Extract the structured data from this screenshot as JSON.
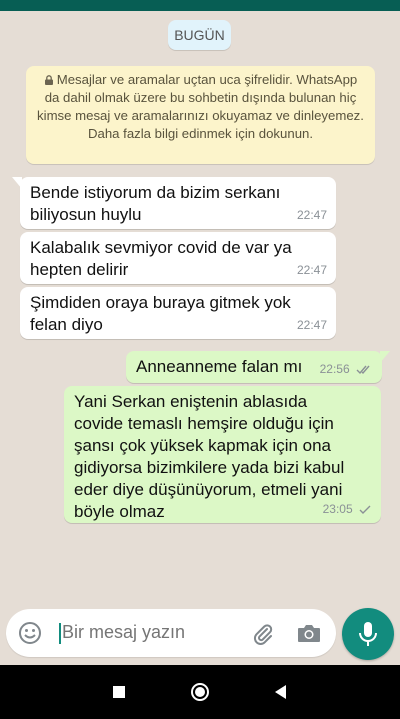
{
  "chat": {
    "date_chip": "BUGÜN",
    "notice": "Mesajlar ve aramalar uçtan uca şifrelidir. WhatsApp da dahil olmak üzere bu sohbetin dışında bulunan hiç kimse mesaj ve aramalarınızı okuyamaz ve dinleyemez. Daha fazla bilgi edinmek için dokunun.",
    "messages": [
      {
        "direction": "incoming",
        "text": "Bende istiyorum da bizim serkanı\nbiliyosun huylu",
        "time": "22:47"
      },
      {
        "direction": "incoming",
        "text": "Kalabalık sevmiyor covid de var ya\nhepten delirir",
        "time": "22:47"
      },
      {
        "direction": "incoming",
        "text": "Şimdiden oraya buraya gitmek yok\nfelan diyo",
        "time": "22:47"
      },
      {
        "direction": "outgoing",
        "text": "Anneanneme falan mı",
        "time": "22:56",
        "status": "read"
      },
      {
        "direction": "outgoing",
        "text": "Yani Serkan eniştenin ablasıda\ncovide temaslı hemşire olduğu için\nşansı çok yüksek kapmak için ona\ngidiyorsa bizimkilere yada bizi kabul\neder diye düşünüyorum, etmeli yani\nböyle olmaz",
        "time": "23:05",
        "status": "sent"
      }
    ]
  },
  "composer": {
    "placeholder": "Bir mesaj yazın",
    "value": ""
  },
  "icons": {
    "emoji": "emoji-icon",
    "attach": "paperclip-icon",
    "camera": "camera-icon",
    "mic": "microphone-icon",
    "lock": "lock-icon",
    "ticks": "check-icon"
  },
  "colors": {
    "header": "#075e54",
    "chat_background": "#e5ddd5",
    "outgoing_bubble": "#dcf8c6",
    "incoming_bubble": "#ffffff",
    "notice_background": "#fcf4cb",
    "accent": "#128c7e",
    "read_ticks": "#8a9096"
  }
}
